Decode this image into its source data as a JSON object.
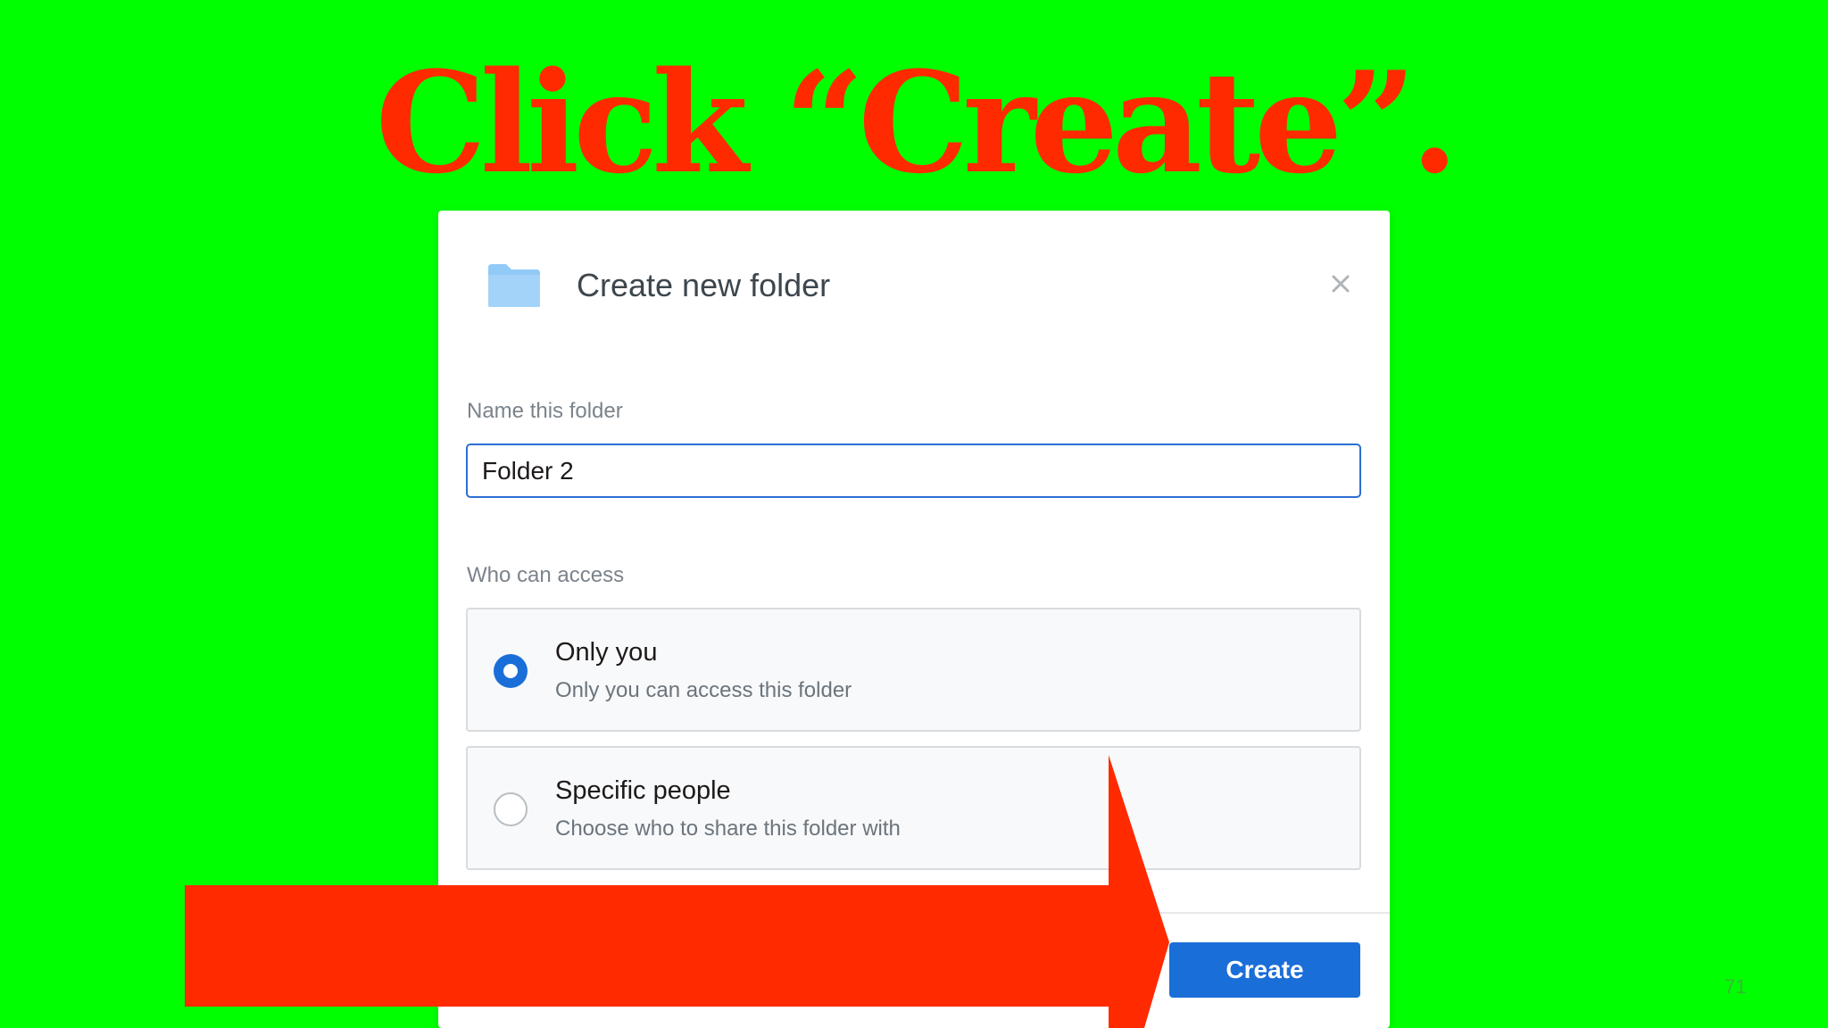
{
  "headline": "Click “Create”.",
  "dialog": {
    "title": "Create new folder",
    "name_label": "Name this folder",
    "name_value": "Folder 2",
    "access_label": "Who can access",
    "options": [
      {
        "title": "Only you",
        "description": "Only you can access this folder",
        "selected": true
      },
      {
        "title": "Specific people",
        "description": "Choose who to share this folder with",
        "selected": false
      }
    ],
    "create_label": "Create"
  },
  "slide_number": "71",
  "colors": {
    "background": "#00ff00",
    "annotation": "#ff2a00",
    "accent": "#1a6ed8",
    "folder": "#91c9f7"
  },
  "icons": {
    "folder": "folder-icon",
    "close": "close-icon",
    "arrow": "arrow-annotation"
  }
}
